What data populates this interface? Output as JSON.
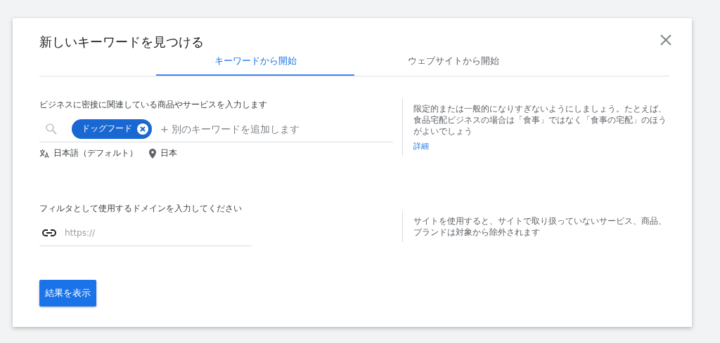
{
  "dialog": {
    "title": "新しいキーワードを見つける"
  },
  "tabs": [
    {
      "label": "キーワードから開始",
      "selected": true
    },
    {
      "label": "ウェブサイトから開始",
      "selected": false
    }
  ],
  "keyword_section": {
    "label": "ビジネスに密接に関連している商品やサービスを入力します",
    "chips": [
      {
        "label": "ドッグフード"
      }
    ],
    "placeholder": "+ 別のキーワードを追加します",
    "language": "日本語（デフォルト）",
    "location": "日本",
    "hint": "限定的または一般的になりすぎないようにしましょう。たとえば、食品宅配ビジネスの場合は「食事」ではなく「食事の宅配」のほうがよいでしょう",
    "hint_link": "詳細"
  },
  "domain_section": {
    "label": "フィルタとして使用するドメインを入力してください",
    "placeholder": "https://",
    "hint": "サイトを使用すると、サイトで取り扱っていないサービス、商品、ブランドは対象から除外されます"
  },
  "submit_button": "結果を表示"
}
